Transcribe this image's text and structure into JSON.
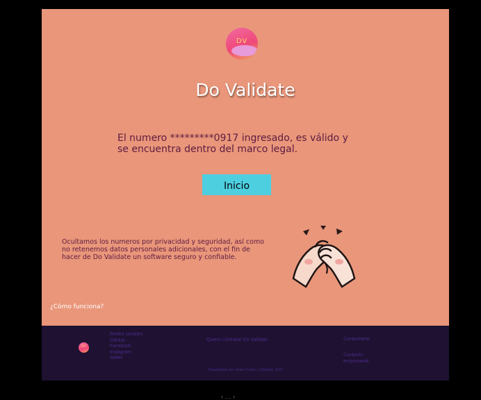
{
  "app": {
    "title": "Do Validate",
    "logo_text": "DV"
  },
  "main": {
    "message": "El numero *********0917 ingresado, es válido y se encuentra dentro del marco legal.",
    "button_label": "Inicio",
    "privacy_note": "Ocultamos los numeros por privacidad y seguridad, así como no retenemos datos personales adicionales, con el fin de hacer de Do Validate un software seguro y confiable.",
    "how_link": "¿Cómo funciona?"
  },
  "footer": {
    "logo_text": "DV",
    "social_header": "Redes sociales",
    "social_links": [
      "GitHub",
      "Facebook",
      "Instagram",
      "twitter"
    ],
    "hire_link": "Quiero contratar Do Validate",
    "contact_link": "Contactame",
    "business_contact": [
      "Contacto",
      "empresarial"
    ],
    "credit": "Desarrollado por: Mateo Castro, Colombia. 2021"
  },
  "colors": {
    "background": "#e9967a",
    "button": "#4dcfe0",
    "footer": "#1e1131",
    "text": "#5e1b41"
  },
  "icons": [
    "logo-icon",
    "clasped-hands-icon"
  ],
  "pager_text": "‹ … ›"
}
